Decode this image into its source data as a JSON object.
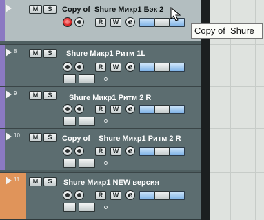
{
  "labels": {
    "mute": "M",
    "solo": "S",
    "read": "R",
    "write": "W",
    "edit": "e"
  },
  "tracks": [
    {
      "number": "",
      "name": "Copy of  Shure Микр1 Бэк 2",
      "color": "#8b79c2",
      "selected": true,
      "record_armed": true
    },
    {
      "number": "8",
      "name": "Shure Микр1 Ритм 1L",
      "color": "#8b79c2",
      "selected": false,
      "record_armed": false
    },
    {
      "number": "9",
      "name": "Shure Микр1 Ритм 2 R",
      "color": "#8b79c2",
      "selected": false,
      "record_armed": false
    },
    {
      "number": "10",
      "name": "Copy of    Shure Микр1 Ритм 2 R",
      "color": "#8b79c2",
      "selected": false,
      "record_armed": false
    },
    {
      "number": "11",
      "name": "Shure Микр1 NEW версия",
      "color": "#e0945a",
      "selected": false,
      "record_armed": false
    }
  ],
  "tooltip": "Copy of  Shure"
}
